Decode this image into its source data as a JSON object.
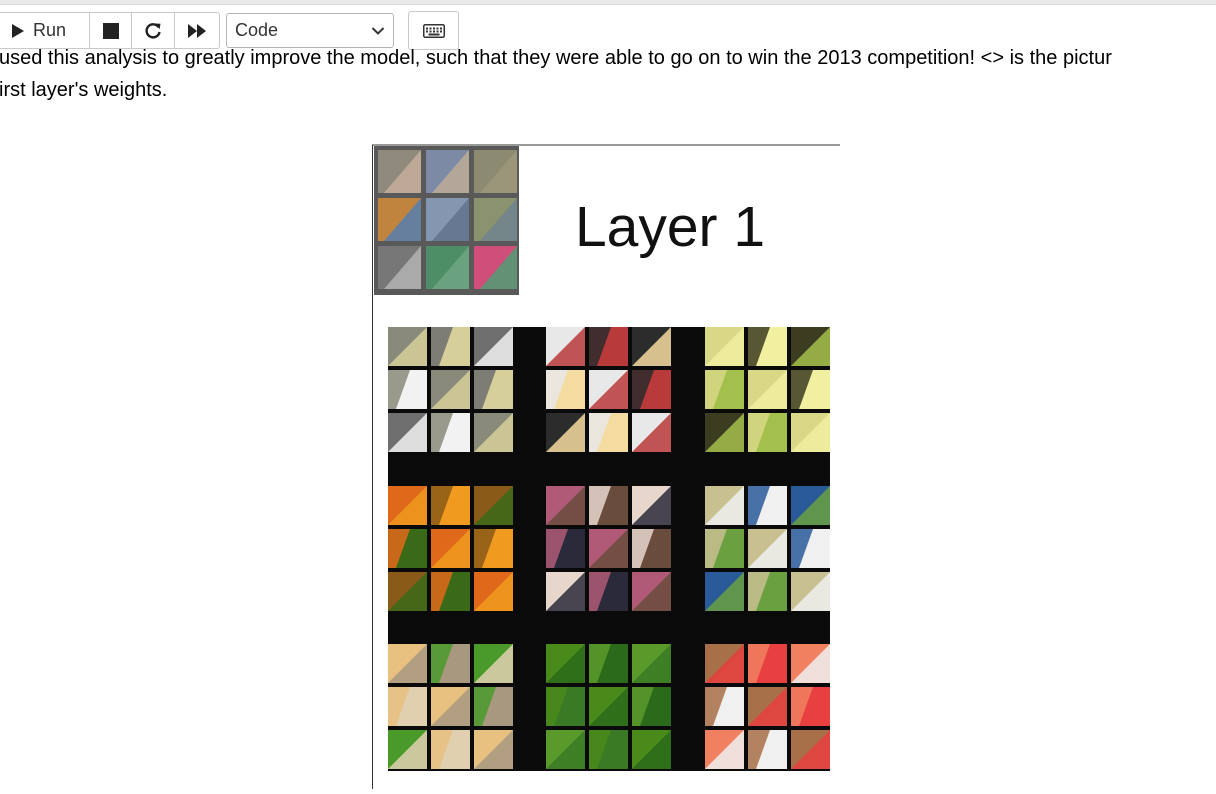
{
  "toolbar": {
    "run_label": "Run",
    "cell_type": "Code",
    "icons": [
      "play-icon",
      "stop-icon",
      "restart-icon",
      "fast-forward-icon",
      "chevron-down-icon",
      "keyboard-icon"
    ]
  },
  "markdown": {
    "line1": "used this analysis to greatly improve the model, such that they were able to go on to win the 2013 competition! <> is the pictur",
    "line2": "irst layer's weights."
  },
  "figure": {
    "label": "Layer 1"
  }
}
